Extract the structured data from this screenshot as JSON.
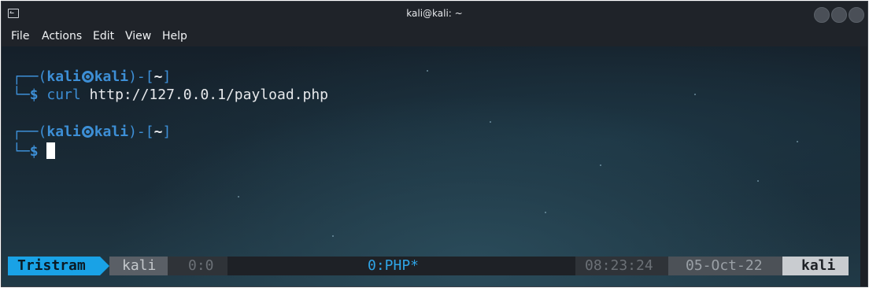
{
  "window": {
    "title": "kali@kali: ~"
  },
  "menu": {
    "items": [
      "File",
      "Actions",
      "Edit",
      "View",
      "Help"
    ]
  },
  "terminal": {
    "prompt1": {
      "frame_open": "┌──(",
      "user": "kali",
      "host": "kali",
      "frame_mid": ")-[",
      "path": "~",
      "frame_close": "]",
      "frame_bottom": "└─",
      "dollar": "$",
      "command": "curl",
      "argument": "http://127.0.0.1/payload.php"
    },
    "prompt2": {
      "frame_open": "┌──(",
      "user": "kali",
      "host": "kali",
      "frame_mid": ")-[",
      "path": "~",
      "frame_close": "]",
      "frame_bottom": "└─",
      "dollar": "$"
    }
  },
  "statusbar": {
    "session": "Tristram",
    "user": "kali",
    "pane": "0:0",
    "window": "0:PHP*",
    "time": "08:23:24",
    "date": "05-Oct-22",
    "host": "kali"
  },
  "colors": {
    "accent": "#3d8fd6",
    "session_bg": "#19a2e6",
    "status_bg": "#1e2126"
  }
}
